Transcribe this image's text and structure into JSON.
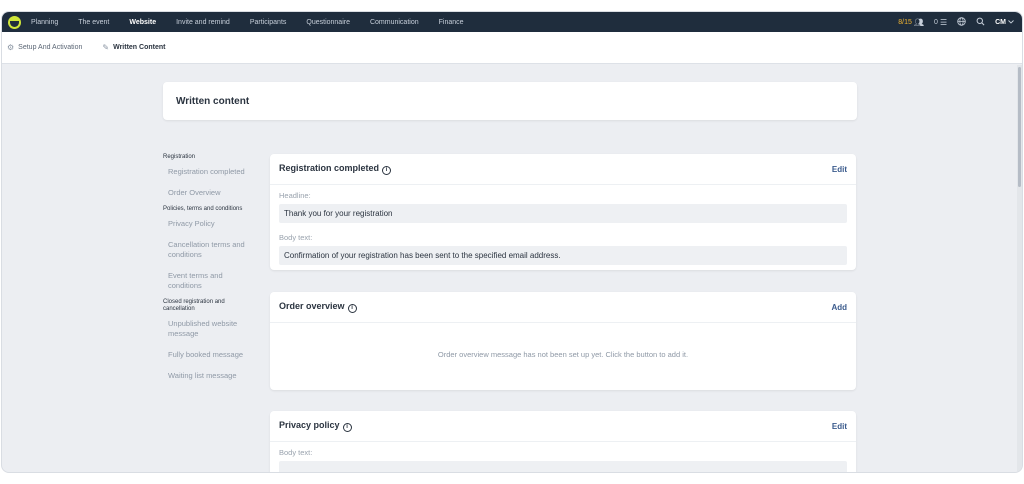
{
  "topnav": {
    "items": [
      {
        "label": "Planning"
      },
      {
        "label": "The event"
      },
      {
        "label": "Website"
      },
      {
        "label": "Invite and remind"
      },
      {
        "label": "Participants"
      },
      {
        "label": "Questionnaire"
      },
      {
        "label": "Communication"
      },
      {
        "label": "Finance"
      }
    ],
    "active": "Website",
    "participants_count": "8/15",
    "tasks_count": "0",
    "user_initials": "CM",
    "accent_color": "#f2b531"
  },
  "subnav": {
    "items": [
      {
        "label": "Setup And Activation",
        "icon": "gear-icon"
      },
      {
        "label": "Written Content",
        "icon": "pencil-icon"
      }
    ]
  },
  "page": {
    "title": "Written content"
  },
  "sidenav": {
    "group_registration": "Registration",
    "registration_completed": "Registration completed",
    "order_overview": "Order Overview",
    "group_policies": "Policies, terms and conditions",
    "privacy_policy": "Privacy Policy",
    "cancellation_terms": "Cancellation terms and conditions",
    "event_terms": "Event terms and conditions",
    "group_closed": "Closed registration and cancellation",
    "unpublished_message": "Unpublished website message",
    "fully_booked": "Fully booked message",
    "waiting_list": "Waiting list message"
  },
  "cards": {
    "registration_completed": {
      "title": "Registration completed",
      "action": "Edit",
      "headline_label": "Headline:",
      "headline_value": "Thank you for your registration",
      "body_label": "Body text:",
      "body_value": "Confirmation of your registration has been sent to the specified email address."
    },
    "order_overview": {
      "title": "Order overview",
      "action": "Add",
      "empty_message": "Order overview message has not been set up yet. Click the button to add it."
    },
    "privacy_policy": {
      "title": "Privacy policy",
      "action": "Edit",
      "body_label": "Body text:",
      "body_value": ""
    }
  }
}
